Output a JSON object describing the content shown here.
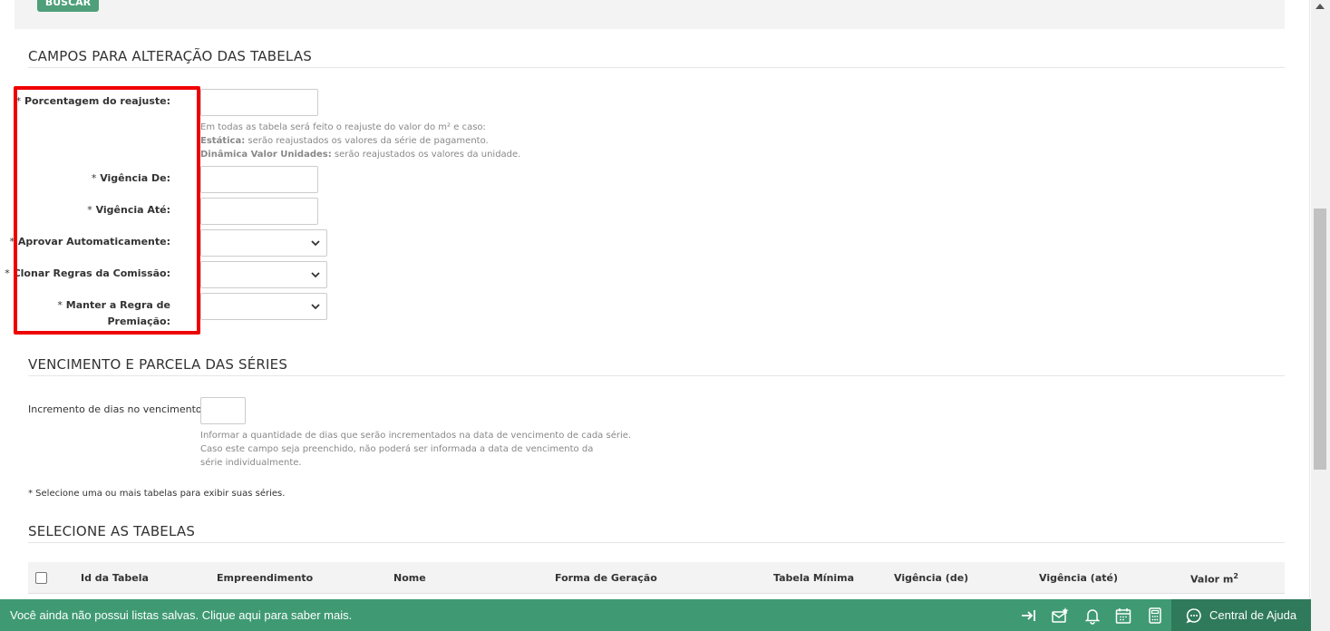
{
  "search": {
    "button_label": "BUSCAR"
  },
  "section_alteracao": {
    "title": "CAMPOS PARA ALTERAÇÃO DAS TABELAS",
    "fields": {
      "porcentagem": {
        "required": "*",
        "label": "Porcentagem do reajuste:"
      },
      "vigencia_de": {
        "required": "*",
        "label": "Vigência De:"
      },
      "vigencia_ate": {
        "required": "*",
        "label": "Vigência Até:"
      },
      "aprovar": {
        "required": "*",
        "label": "Aprovar Automaticamente:"
      },
      "clonar": {
        "required": "*",
        "label": "Clonar Regras da Comissão:"
      },
      "manter_line1": {
        "required": "*",
        "label": "Manter a Regra de"
      },
      "manter_line2": "Premiação:"
    },
    "help": {
      "line1": "Em todas as tabela será feito o reajuste do valor do m² e caso:",
      "line2_bold": "Estática:",
      "line2_rest": " serão reajustados os valores da série de pagamento.",
      "line3_bold": "Dinâmica Valor Unidades:",
      "line3_rest": " serão reajustados os valores da unidade."
    }
  },
  "section_vencimento": {
    "title": "VENCIMENTO E PARCELA DAS SÉRIES",
    "increment_label": "Incremento de dias no vencimento:",
    "help": {
      "line1": "Informar a quantidade de dias que serão incrementados na data de vencimento de cada série.",
      "line2": "Caso este campo seja preenchido, não poderá ser informada a data de vencimento da",
      "line3": "série individualmente."
    }
  },
  "note": "* Selecione uma ou mais tabelas para exibir suas séries.",
  "section_tabelas": {
    "title": "SELECIONE AS TABELAS",
    "columns": [
      "Id da Tabela",
      "Empreendimento",
      "Nome",
      "Forma de Geração",
      "Tabela Mínima",
      "Vigência (de)",
      "Vigência (até)",
      "Valor m"
    ],
    "valor_sup": "2"
  },
  "footer": {
    "message": "Você ainda não possui listas salvas. Clique aqui para saber mais.",
    "help_center": "Central de Ajuda",
    "icons": [
      "sidebar-toggle-icon",
      "mail-star-icon",
      "bell-icon",
      "calendar-icon",
      "calculator-icon",
      "chat-help-icon"
    ]
  },
  "colors": {
    "accent": "#3f9a73",
    "highlight": "#ee0000"
  }
}
